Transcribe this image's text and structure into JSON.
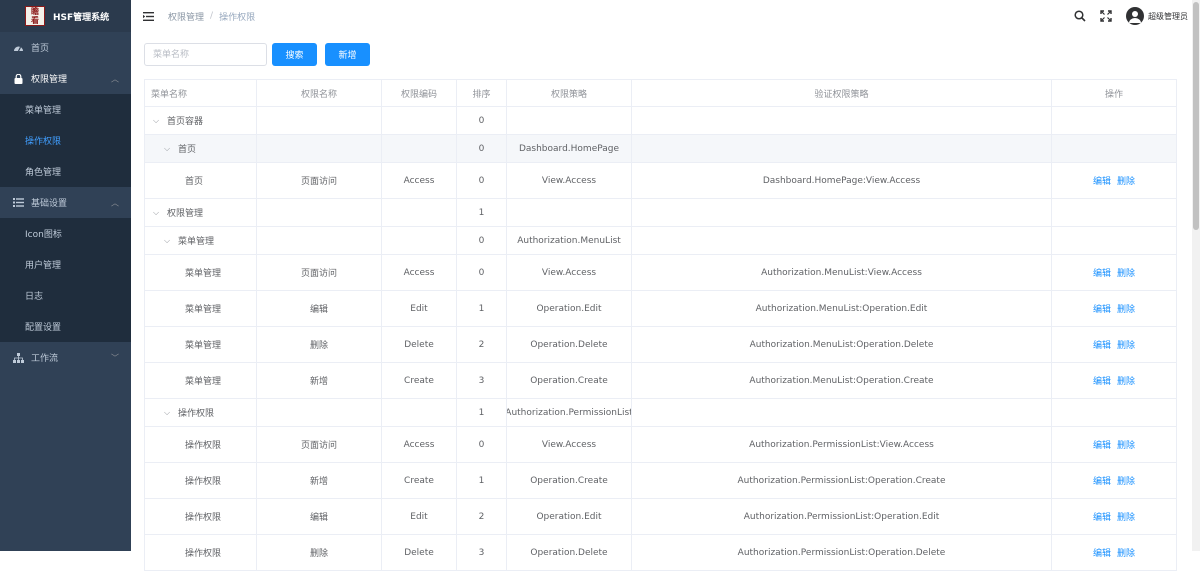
{
  "app": {
    "title": "HSF管理系统",
    "logo_text": "瞻\n看"
  },
  "sidebar": {
    "items": [
      {
        "label": "首页",
        "icon": "dashboard-icon"
      },
      {
        "label": "权限管理",
        "icon": "lock-icon",
        "children": [
          "菜单管理",
          "操作权限",
          "角色管理"
        ]
      },
      {
        "label": "基础设置",
        "icon": "list-icon",
        "children": [
          "Icon图标",
          "用户管理",
          "日志",
          "配置设置"
        ]
      },
      {
        "label": "工作流",
        "icon": "sitemap-icon"
      }
    ]
  },
  "breadcrumb": [
    "权限管理",
    "操作权限"
  ],
  "user": {
    "name": "超级管理员"
  },
  "filter": {
    "placeholder": "菜单名称",
    "value": "",
    "search_label": "搜索",
    "add_label": "新增"
  },
  "table": {
    "headers": [
      "菜单名称",
      "权限名称",
      "权限编码",
      "排序",
      "权限策略",
      "验证权限策略",
      "操作"
    ],
    "rows": [
      {
        "type": "p",
        "level": 0,
        "menu": "首页容器",
        "perm": "",
        "code": "",
        "order": "0",
        "policy": "",
        "verify": "",
        "ops": false
      },
      {
        "type": "p",
        "level": 1,
        "menu": "首页",
        "perm": "",
        "code": "",
        "order": "0",
        "policy": "Dashboard.HomePage",
        "verify": "",
        "ops": false,
        "highlight": true
      },
      {
        "type": "l",
        "level": 2,
        "menu": "首页",
        "perm": "页面访问",
        "code": "Access",
        "order": "0",
        "policy": "View.Access",
        "verify": "Dashboard.HomePage:View.Access",
        "ops": true
      },
      {
        "type": "p",
        "level": 0,
        "menu": "权限管理",
        "perm": "",
        "code": "",
        "order": "1",
        "policy": "",
        "verify": "",
        "ops": false
      },
      {
        "type": "p",
        "level": 1,
        "menu": "菜单管理",
        "perm": "",
        "code": "",
        "order": "0",
        "policy": "Authorization.MenuList",
        "verify": "",
        "ops": false
      },
      {
        "type": "l",
        "level": 2,
        "menu": "菜单管理",
        "perm": "页面访问",
        "code": "Access",
        "order": "0",
        "policy": "View.Access",
        "verify": "Authorization.MenuList:View.Access",
        "ops": true
      },
      {
        "type": "l",
        "level": 2,
        "menu": "菜单管理",
        "perm": "编辑",
        "code": "Edit",
        "order": "1",
        "policy": "Operation.Edit",
        "verify": "Authorization.MenuList:Operation.Edit",
        "ops": true
      },
      {
        "type": "l",
        "level": 2,
        "menu": "菜单管理",
        "perm": "删除",
        "code": "Delete",
        "order": "2",
        "policy": "Operation.Delete",
        "verify": "Authorization.MenuList:Operation.Delete",
        "ops": true
      },
      {
        "type": "l",
        "level": 2,
        "menu": "菜单管理",
        "perm": "新增",
        "code": "Create",
        "order": "3",
        "policy": "Operation.Create",
        "verify": "Authorization.MenuList:Operation.Create",
        "ops": true
      },
      {
        "type": "p",
        "level": 1,
        "menu": "操作权限",
        "perm": "",
        "code": "",
        "order": "1",
        "policy": "Authorization.PermissionList",
        "verify": "",
        "ops": false
      },
      {
        "type": "l",
        "level": 2,
        "menu": "操作权限",
        "perm": "页面访问",
        "code": "Access",
        "order": "0",
        "policy": "View.Access",
        "verify": "Authorization.PermissionList:View.Access",
        "ops": true
      },
      {
        "type": "l",
        "level": 2,
        "menu": "操作权限",
        "perm": "新增",
        "code": "Create",
        "order": "1",
        "policy": "Operation.Create",
        "verify": "Authorization.PermissionList:Operation.Create",
        "ops": true
      },
      {
        "type": "l",
        "level": 2,
        "menu": "操作权限",
        "perm": "编辑",
        "code": "Edit",
        "order": "2",
        "policy": "Operation.Edit",
        "verify": "Authorization.PermissionList:Operation.Edit",
        "ops": true
      },
      {
        "type": "l",
        "level": 2,
        "menu": "操作权限",
        "perm": "删除",
        "code": "Delete",
        "order": "3",
        "policy": "Operation.Delete",
        "verify": "Authorization.PermissionList:Operation.Delete",
        "ops": true
      }
    ],
    "edit_label": "编辑",
    "delete_label": "删除",
    "expand_symbol": "⌵"
  },
  "colors": {
    "sidebar_bg": "#304156",
    "accent": "#1890ff",
    "active_menu": "#409eff"
  }
}
